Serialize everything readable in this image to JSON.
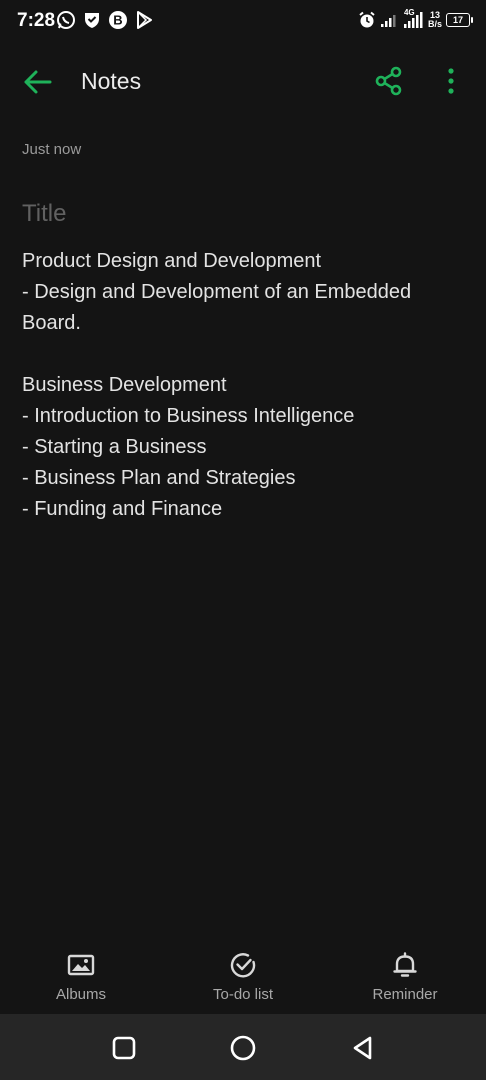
{
  "status_bar": {
    "time": "7:28",
    "net_speed_value": "13",
    "net_speed_unit": "B/s",
    "battery_level": "17",
    "network_type": "4G",
    "left_icons": [
      "whatsapp-icon",
      "shield-icon",
      "b-app-icon",
      "play-store-icon"
    ],
    "right_icons": [
      "alarm-icon",
      "signal-icon",
      "signal-4g-icon",
      "battery-icon"
    ]
  },
  "app_bar": {
    "title": "Notes",
    "back_icon": "arrow-left-icon",
    "share_icon": "share-icon",
    "more_icon": "more-vertical-icon",
    "accent_color": "#1fb25a"
  },
  "note": {
    "timestamp": "Just now",
    "title_placeholder": "Title",
    "body_lines": [
      "Product Design and Development",
      "- Design and Development of an Embedded",
      "Board.",
      "",
      "Business Development",
      "- Introduction to Business Intelligence",
      "- Starting a Business",
      "- Business Plan and Strategies",
      "- Funding and Finance"
    ]
  },
  "toolbar": {
    "albums_label": "Albums",
    "todo_label": "To-do list",
    "reminder_label": "Reminder"
  },
  "nav_bar": {
    "buttons": [
      "recents-square-icon",
      "home-circle-icon",
      "back-triangle-icon"
    ]
  },
  "colors": {
    "background": "#141414",
    "nav_bar": "#262626",
    "accent": "#1fb25a",
    "text": "#e3e3e3",
    "muted_text": "#9a9a9a",
    "placeholder": "#616161"
  }
}
